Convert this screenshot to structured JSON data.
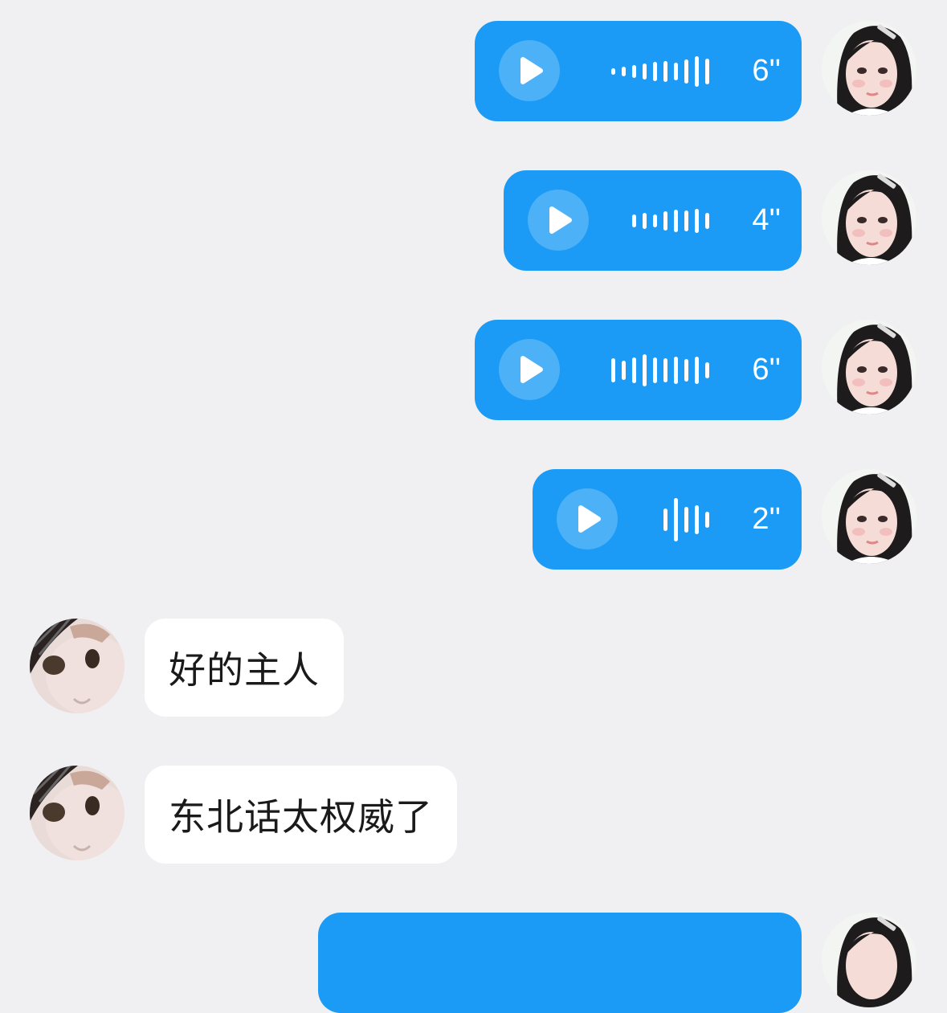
{
  "colors": {
    "background": "#f0f0f3",
    "sent_bubble": "#1b9bf6",
    "received_bubble": "#ffffff",
    "text": "#1a1a1a"
  },
  "messages": [
    {
      "type": "voice",
      "sender": "me",
      "duration": "6''",
      "icon": "play-icon"
    },
    {
      "type": "voice",
      "sender": "me",
      "duration": "4''",
      "icon": "play-icon"
    },
    {
      "type": "voice",
      "sender": "me",
      "duration": "6''",
      "icon": "play-icon"
    },
    {
      "type": "voice",
      "sender": "me",
      "duration": "2''",
      "icon": "play-icon"
    },
    {
      "type": "text",
      "sender": "other",
      "text": "好的主人"
    },
    {
      "type": "text",
      "sender": "other",
      "text": "东北话太权威了"
    },
    {
      "type": "voice",
      "sender": "me",
      "duration": "",
      "icon": "play-icon"
    }
  ]
}
